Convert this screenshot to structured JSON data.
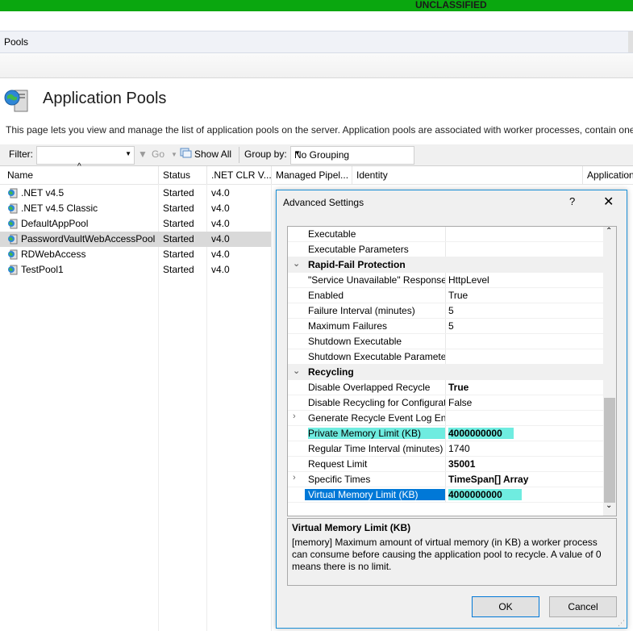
{
  "banner": {
    "text": "UNCLASSIFIED",
    "color": "#0aa70f"
  },
  "breadcrumb": {
    "text": "Pools"
  },
  "page": {
    "title": "Application Pools",
    "description": "This page lets you view and manage the list of application pools on the server. Application pools are associated with worker processes, contain one o"
  },
  "toolbar": {
    "filter_label": "Filter:",
    "go_label": "Go",
    "show_all_label": "Show All",
    "group_by_label": "Group by:",
    "group_by_value": "No Grouping"
  },
  "columns": [
    "Name",
    "Status",
    ".NET CLR V...",
    "Managed Pipel...",
    "Identity",
    "Application"
  ],
  "pools": [
    {
      "name": ".NET v4.5",
      "status": "Started",
      "clr": "v4.0"
    },
    {
      "name": ".NET v4.5 Classic",
      "status": "Started",
      "clr": "v4.0"
    },
    {
      "name": "DefaultAppPool",
      "status": "Started",
      "clr": "v4.0"
    },
    {
      "name": "PasswordVaultWebAccessPool",
      "status": "Started",
      "clr": "v4.0"
    },
    {
      "name": "RDWebAccess",
      "status": "Started",
      "clr": "v4.0"
    },
    {
      "name": "TestPool1",
      "status": "Started",
      "clr": "v4.0"
    }
  ],
  "dialog": {
    "title": "Advanced Settings",
    "help_label": "?",
    "close_label": "✕",
    "properties": [
      {
        "name": "Executable",
        "value": "",
        "type": "prop"
      },
      {
        "name": "Executable Parameters",
        "value": "",
        "type": "prop"
      },
      {
        "name": "Rapid-Fail Protection",
        "value": "",
        "type": "category"
      },
      {
        "name": "\"Service Unavailable\" Response Type",
        "value": "HttpLevel",
        "type": "prop"
      },
      {
        "name": "Enabled",
        "value": "True",
        "type": "prop"
      },
      {
        "name": "Failure Interval (minutes)",
        "value": "5",
        "type": "prop"
      },
      {
        "name": "Maximum Failures",
        "value": "5",
        "type": "prop"
      },
      {
        "name": "Shutdown Executable",
        "value": "",
        "type": "prop"
      },
      {
        "name": "Shutdown Executable Parameters",
        "value": "",
        "type": "prop"
      },
      {
        "name": "Recycling",
        "value": "",
        "type": "category"
      },
      {
        "name": "Disable Overlapped Recycle",
        "value": "True",
        "type": "prop",
        "bold": true
      },
      {
        "name": "Disable Recycling for Configuration Changes",
        "value": "False",
        "type": "prop"
      },
      {
        "name": "Generate Recycle Event Log Entry",
        "value": "",
        "type": "expandable"
      },
      {
        "name": "Private Memory Limit (KB)",
        "value": "4000000000",
        "type": "prop",
        "bold": true,
        "highlight": true
      },
      {
        "name": "Regular Time Interval (minutes)",
        "value": "1740",
        "type": "prop"
      },
      {
        "name": "Request Limit",
        "value": "35001",
        "type": "prop",
        "bold": true
      },
      {
        "name": "Specific Times",
        "value": "TimeSpan[] Array",
        "type": "expandable",
        "bold": true
      },
      {
        "name": "Virtual Memory Limit (KB)",
        "value": "4000000000",
        "type": "prop",
        "bold": true,
        "highlight": true,
        "selected": true
      }
    ],
    "description_title": "Virtual Memory Limit (KB)",
    "description_text": "[memory] Maximum amount of virtual memory (in KB) a worker process can consume before causing the application pool to recycle.  A value of 0 means there is no limit.",
    "ok_label": "OK",
    "cancel_label": "Cancel"
  },
  "colors": {
    "selection": "#0078d7",
    "highlight": "#6fece0",
    "dialog_border": "#1a8fd6"
  }
}
